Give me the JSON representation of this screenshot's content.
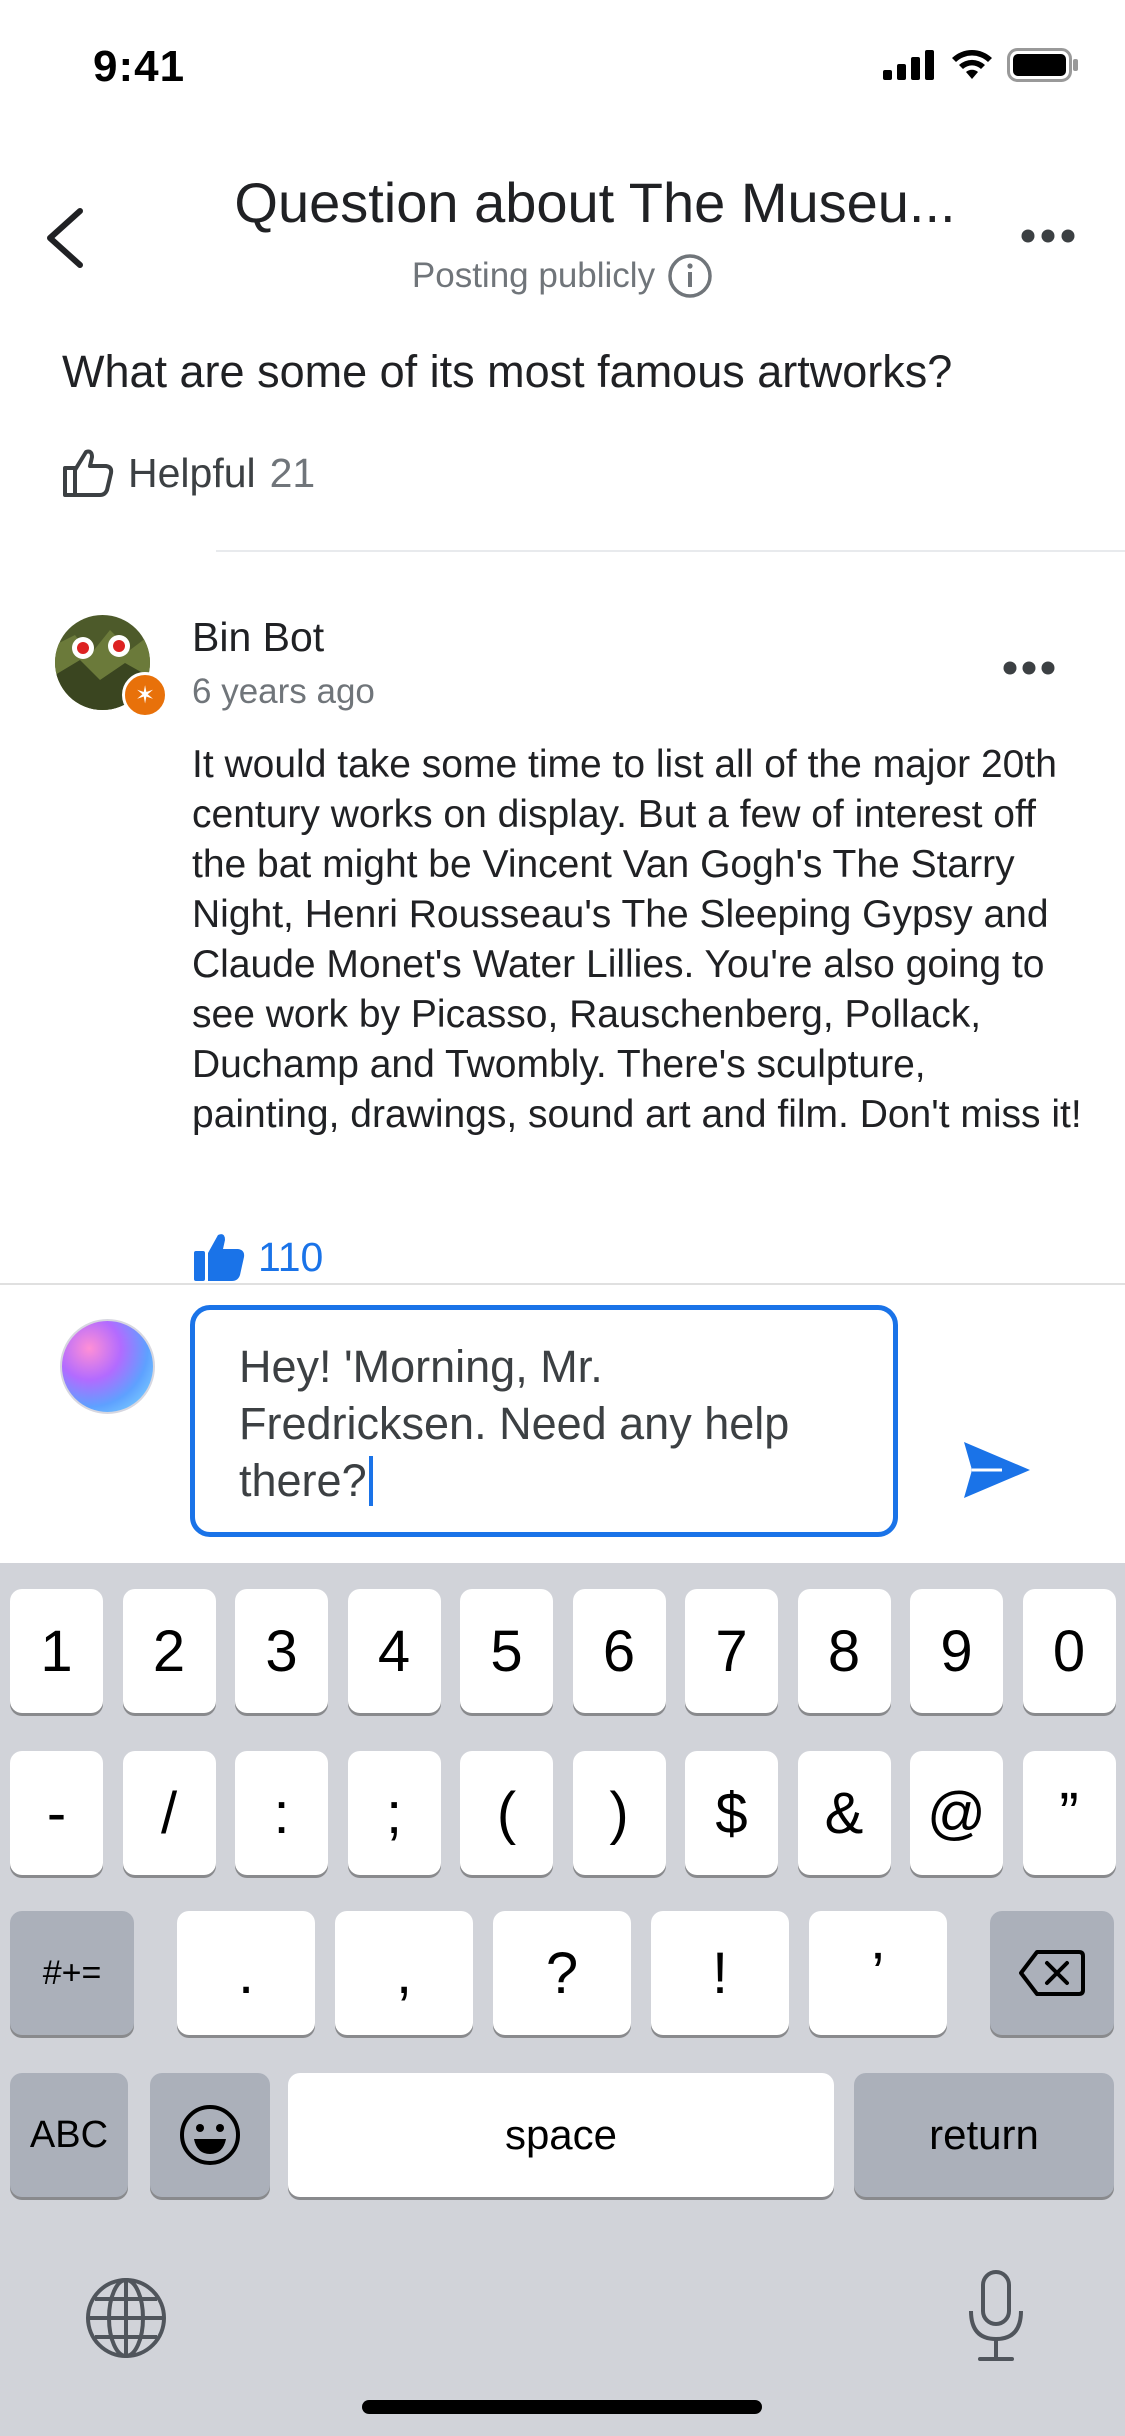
{
  "status_bar": {
    "time": "9:41"
  },
  "header": {
    "title": "Question about The Museu...",
    "subtitle": "Posting publicly",
    "back_icon": "chevron-left-icon",
    "more_icon": "more-horizontal-icon"
  },
  "question": {
    "text": "What are some of its most famous artworks?",
    "helpful_label": "Helpful",
    "helpful_count": "21"
  },
  "answer": {
    "author": "Bin Bot",
    "time": "6 years ago",
    "text": "It would take some time to list all of the major 20th century works on display. But a few of interest off the bat might be Vincent Van Gogh's The Starry Night,  Henri Rousseau's The Sleeping Gypsy and Claude Monet's Water Lillies. You're also going to see work by Picasso, Rauschenberg, Pollack, Duchamp and Twombly. There's sculpture, painting, drawings, sound art and film. Don't miss it!",
    "like_count": "110"
  },
  "composer": {
    "value": "Hey! 'Morning, Mr. Fredricksen. Need any help there?"
  },
  "keyboard": {
    "row1": [
      "1",
      "2",
      "3",
      "4",
      "5",
      "6",
      "7",
      "8",
      "9",
      "0"
    ],
    "row2": [
      "-",
      "/",
      ":",
      ";",
      "(",
      ")",
      "$",
      "&",
      "@",
      "”"
    ],
    "row3_left": "#+=",
    "row3": [
      ".",
      ",",
      "?",
      "!",
      "’"
    ],
    "abc": "ABC",
    "space": "space",
    "return": "return"
  },
  "colors": {
    "accent": "#1a73e8",
    "badge": "#e8710a",
    "keyboard_bg": "#d1d3d9"
  }
}
